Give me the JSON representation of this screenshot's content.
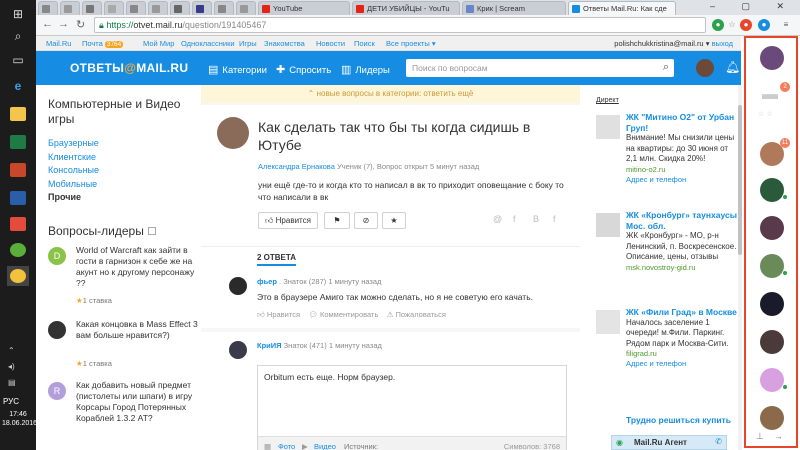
{
  "browser": {
    "tabs": [
      {
        "label": "YouTube",
        "color": "#e62117"
      },
      {
        "label": "ДЕТИ УБИЙЦЫ - YouTu",
        "color": "#e62117"
      },
      {
        "label": "Крик | Scream",
        "color": "#6a86c9"
      },
      {
        "label": "Ответы Mail.Ru: Как сде",
        "color": "#168de2"
      }
    ],
    "url_scheme": "https://",
    "url_host": "otvet.mail.ru",
    "url_path": "/question/191405467",
    "window_controls": "– ▢ ✕"
  },
  "portal": {
    "links": [
      "Mail.Ru",
      "Почта",
      "Мой Мир",
      "Одноклассники",
      "Игры",
      "Знакомства",
      "Новости",
      "Поиск",
      "Все проекты ▾"
    ],
    "mail_count": "3764",
    "user": "polishchukkristina@mail.ru ▾",
    "logout": "выход"
  },
  "header": {
    "logo_pre": "ОТВЕТЫ",
    "logo_at": "@",
    "logo_post": "MAIL.RU",
    "categories": "Категории",
    "ask": "Спросить",
    "leaders": "Лидеры",
    "search_placeholder": "Поиск по вопросам"
  },
  "left": {
    "category_title": "Компьютерные и Видео игры",
    "subcats": [
      "Браузерные",
      "Клиентские",
      "Консольные",
      "Мобильные"
    ],
    "current": "Прочие",
    "leaders_title": "Вопросы-лидеры",
    "questions": [
      {
        "avatar": "D",
        "color": "#8bc34a",
        "text": "World of Warcraft как зайти в гости в гарнизон к себе же на акунт но к другому персонажу ??",
        "bet": "1 ставка"
      },
      {
        "avatar": "",
        "color": "#333333",
        "text": "Какая концовка в Mass Effect 3 вам больше нравится?)",
        "bet": "1 ставка"
      },
      {
        "avatar": "R",
        "color": "#b39ddb",
        "text": "Как добавить новый предмет (пистолеты или шпаги) в игру Корсары Город Потерянных Кораблей 1.3.2 AT?",
        "bet": ""
      }
    ]
  },
  "main": {
    "new_questions": "новые вопросы в категории: ответить ещё",
    "title": "Как сделать так что бы ты когда сидишь в Ютубе",
    "author": "Александра Ернакова",
    "meta": "Ученик (7), Вопрос открыт 5 минут назад",
    "body": "уни ещё где-то и когда кто то написал в вк то приходит оповещание с боку то что написали в вк",
    "like": "Нравится",
    "share_icons": [
      "@",
      "f",
      "B",
      "f"
    ],
    "answers_label": "2 ОТВЕТА",
    "answers": [
      {
        "name": "фьер",
        "meta": "Знаток (287)  1 минуту назад",
        "text": "Это в браузере Амиго так можно сделать, но я не советую его качать.",
        "like": "Нравится",
        "comment": "Комментировать",
        "report": "Пожаловаться"
      },
      {
        "name": "КриИЯ",
        "meta": "Знаток (471)  1 минуту назад"
      }
    ],
    "reply_value": "Orbitum есть еще. Норм браузер.",
    "reply_photo": "Фото",
    "reply_video": "Видео",
    "reply_source": "Источник:",
    "reply_chars": "Символов: 3768"
  },
  "ads": {
    "direkt": "Директ",
    "items": [
      {
        "title": "ЖК \"Митино О2\" от Урбан Груп!",
        "body": "Внимание! Мы снизили цены на квартиры: до 30 июня от 2,1 млн. Скидка 20%!",
        "url": "mitino-o2.ru",
        "sub": "Адрес и телефон"
      },
      {
        "title": "ЖК «Кронбург» таунхаусы Мос. обл.",
        "body": "ЖК «Кронбург» - МО, р-н Ленинский, п. Воскресенское. Описание, цены, отзывы",
        "url": "msk.novostroy-gid.ru",
        "sub": ""
      },
      {
        "title": "ЖК «Фили Град» в Москве",
        "body": "Началось заселение 1 очереди! м.Фили. Паркинг. Рядом парк и Москва-Сити.",
        "url": "filigrad.ru",
        "sub": "Адрес и телефон"
      },
      {
        "title": "Трудно решиться купить",
        "body": "",
        "url": "",
        "sub": ""
      }
    ],
    "agent": "Mail.Ru Агент"
  },
  "rpanel": {
    "badges": [
      "2",
      "11"
    ]
  },
  "taskbar": {
    "lang": "РУС",
    "time": "17:46",
    "date": "18.06.2016"
  }
}
